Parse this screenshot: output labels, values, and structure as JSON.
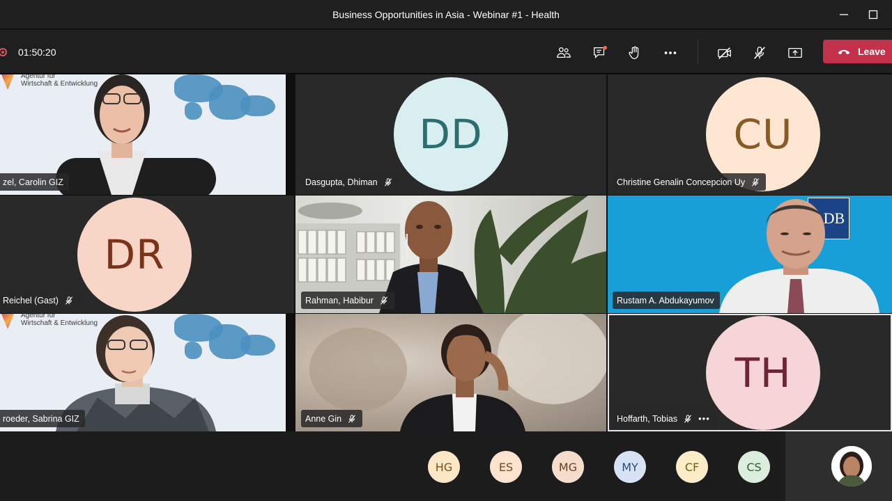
{
  "window": {
    "title": "Business Opportunities in Asia - Webinar #1 - Health",
    "minimize_icon": "minimize-icon",
    "maximize_icon": "maximize-icon"
  },
  "toolbar": {
    "recording_indicator": "recording-dot-icon",
    "timer": "01:50:20",
    "icons": [
      "participants-icon",
      "chat-icon",
      "raise-hand-icon",
      "more-icon",
      "camera-off-icon",
      "mic-off-icon",
      "share-icon"
    ],
    "leave_label": "Leave",
    "leave_color": "#c4314b"
  },
  "tiles": [
    {
      "name": "zel, Carolin GIZ",
      "type": "video",
      "scene": "map",
      "logo_line1": "Agentur für",
      "logo_line2": "Wirtschaft & Entwicklung",
      "muted": false
    },
    {
      "name": "Dasgupta, Dhiman",
      "type": "avatar",
      "initials": "DD",
      "bg": "#d8eef1",
      "fg": "#2a6e70",
      "muted": true
    },
    {
      "name": "Christine Genalin Concepcion Uy",
      "type": "avatar",
      "initials": "CU",
      "bg": "#fde7d3",
      "fg": "#8a5a25",
      "muted": true
    },
    {
      "name": "Reichel (Gast)",
      "type": "avatar",
      "initials": "DR",
      "bg": "#f7d6c7",
      "fg": "#7a3319",
      "muted": true
    },
    {
      "name": "Rahman, Habibur",
      "type": "video",
      "scene": "office",
      "muted": true
    },
    {
      "name": "Rustam A. Abdukayumov",
      "type": "video",
      "scene": "blue",
      "logo": "ADB",
      "muted": false
    },
    {
      "name": "roeder, Sabrina GIZ",
      "type": "video",
      "scene": "map",
      "logo_line1": "Agentur für",
      "logo_line2": "Wirtschaft & Entwicklung",
      "muted": false
    },
    {
      "name": "Anne Gin",
      "type": "video",
      "scene": "blur",
      "muted": true
    },
    {
      "name": "Hoffarth, Tobias",
      "type": "avatar",
      "initials": "TH",
      "bg": "#f5d5d7",
      "fg": "#6e2531",
      "muted": true,
      "more": "•••"
    }
  ],
  "overflow": [
    {
      "initials": "HG",
      "bg": "#fbe6c6",
      "fg": "#7a4e1a"
    },
    {
      "initials": "ES",
      "bg": "#fbe3cf",
      "fg": "#7a4721"
    },
    {
      "initials": "MG",
      "bg": "#f6dccb",
      "fg": "#6e3b22"
    },
    {
      "initials": "MY",
      "bg": "#d7e3f4",
      "fg": "#2b4a77"
    },
    {
      "initials": "CF",
      "bg": "#fbedc8",
      "fg": "#7a5a10"
    },
    {
      "initials": "CS",
      "bg": "#dbeedd",
      "fg": "#2d5b32"
    }
  ]
}
